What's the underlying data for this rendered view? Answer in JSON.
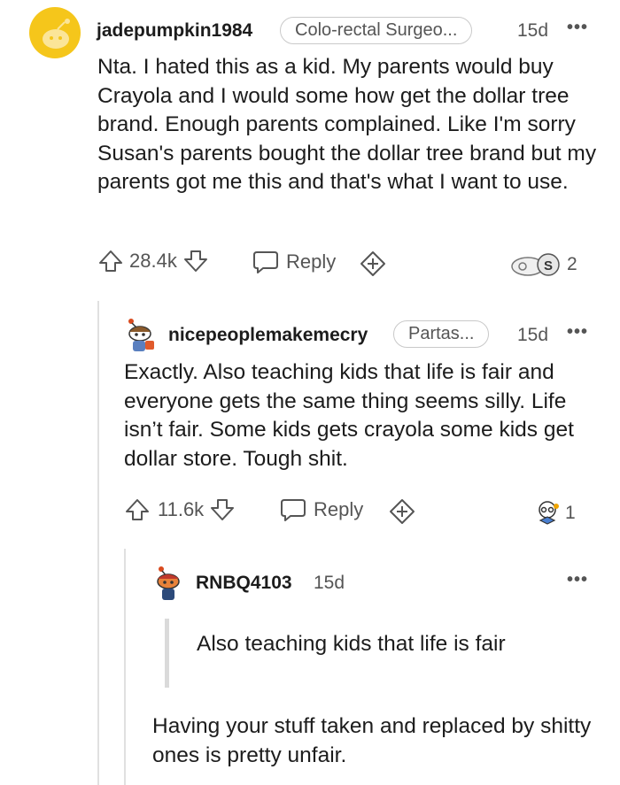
{
  "comments": [
    {
      "username": "jadepumpkin1984",
      "flair": "Colo-rectal Surgeo...",
      "time": "15d",
      "more": "•••",
      "body": "Nta. I hated this as a kid. My parents would buy Crayola and I would some how get the dollar tree brand. Enough parents complained. Like I'm sorry Susan's parents bought the dollar tree brand but my parents got me this and that's what I want to use.",
      "upvotes": "28.4k",
      "reply_label": "Reply",
      "award_count": "2"
    },
    {
      "username": "nicepeoplemakemecry",
      "flair": "Partas...",
      "time": "15d",
      "more": "•••",
      "body": "Exactly. Also teaching kids that life is fair and everyone gets the same thing seems silly. Life isn’t fair. Some kids gets crayola some kids get dollar store. Tough shit.",
      "upvotes": "11.6k",
      "reply_label": "Reply",
      "award_count": "1"
    },
    {
      "username": "RNBQ4103",
      "time": "15d",
      "more": "•••",
      "quote": "Also teaching kids that life is fair",
      "body": "Having your stuff taken and replaced by shitty ones is pretty unfair."
    }
  ],
  "colors": {
    "avatar_yellow": "#f5c61b",
    "text": "#1c1c1c",
    "muted": "#555555"
  },
  "icons": [
    "avatar-icon",
    "upvote-arrow-icon",
    "downvote-arrow-icon",
    "reply-bubble-icon",
    "give-award-icon",
    "award-icon"
  ]
}
